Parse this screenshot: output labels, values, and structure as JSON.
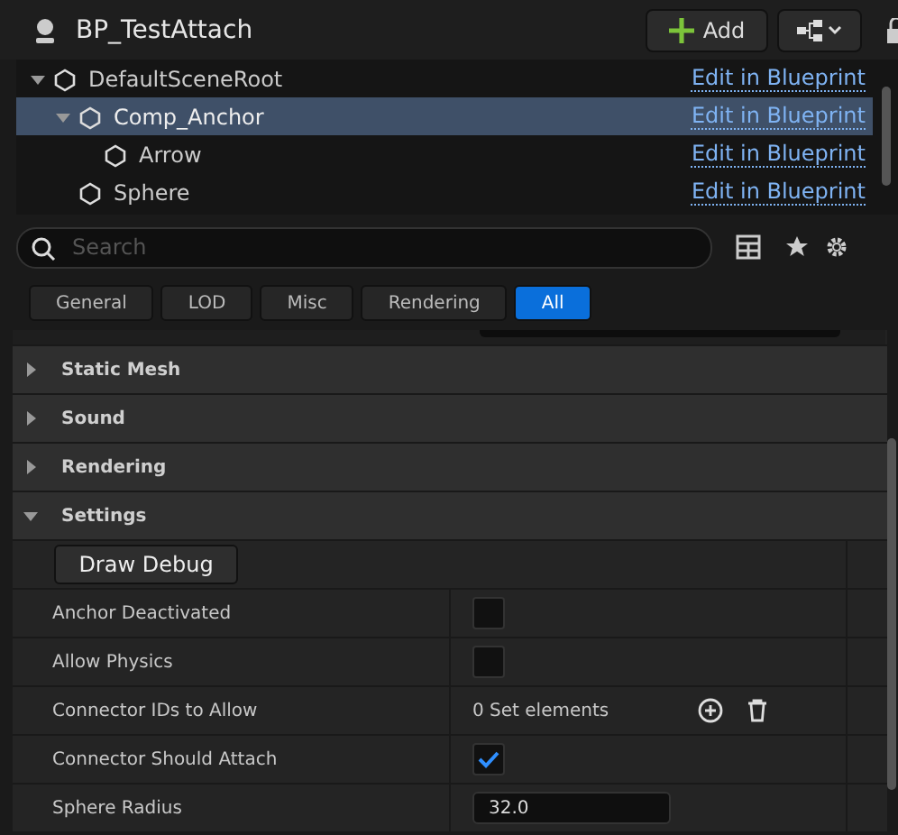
{
  "header": {
    "title": "BP_TestAttach",
    "add_button": "Add"
  },
  "tree": [
    {
      "name": "DefaultSceneRoot",
      "link": "Edit in Blueprint",
      "selected": false,
      "expanded": true,
      "children": [
        {
          "name": "Comp_Anchor",
          "link": "Edit in Blueprint",
          "selected": true,
          "expanded": true,
          "children": [
            {
              "name": "Arrow",
              "link": "Edit in Blueprint",
              "selected": false
            }
          ]
        },
        {
          "name": "Sphere",
          "link": "Edit in Blueprint",
          "selected": false
        }
      ]
    }
  ],
  "search": {
    "placeholder": "Search"
  },
  "filters": [
    {
      "label": "General",
      "selected": false
    },
    {
      "label": "LOD",
      "selected": false
    },
    {
      "label": "Misc",
      "selected": false
    },
    {
      "label": "Rendering",
      "selected": false
    },
    {
      "label": "All",
      "selected": true
    }
  ],
  "categories": [
    {
      "label": "Static Mesh",
      "expanded": false
    },
    {
      "label": "Sound",
      "expanded": false
    },
    {
      "label": "Rendering",
      "expanded": false
    },
    {
      "label": "Settings",
      "expanded": true
    }
  ],
  "settings": {
    "button": "Draw Debug",
    "properties": [
      {
        "kind": "checkbox",
        "label": "Anchor Deactivated",
        "checked": false
      },
      {
        "kind": "checkbox",
        "label": "Allow Physics",
        "checked": false
      },
      {
        "kind": "set",
        "label": "Connector IDs to Allow",
        "value": "0 Set elements"
      },
      {
        "kind": "checkbox",
        "label": "Connector Should Attach",
        "checked": true
      },
      {
        "kind": "number",
        "label": "Sphere Radius",
        "value": "32.0"
      }
    ]
  }
}
